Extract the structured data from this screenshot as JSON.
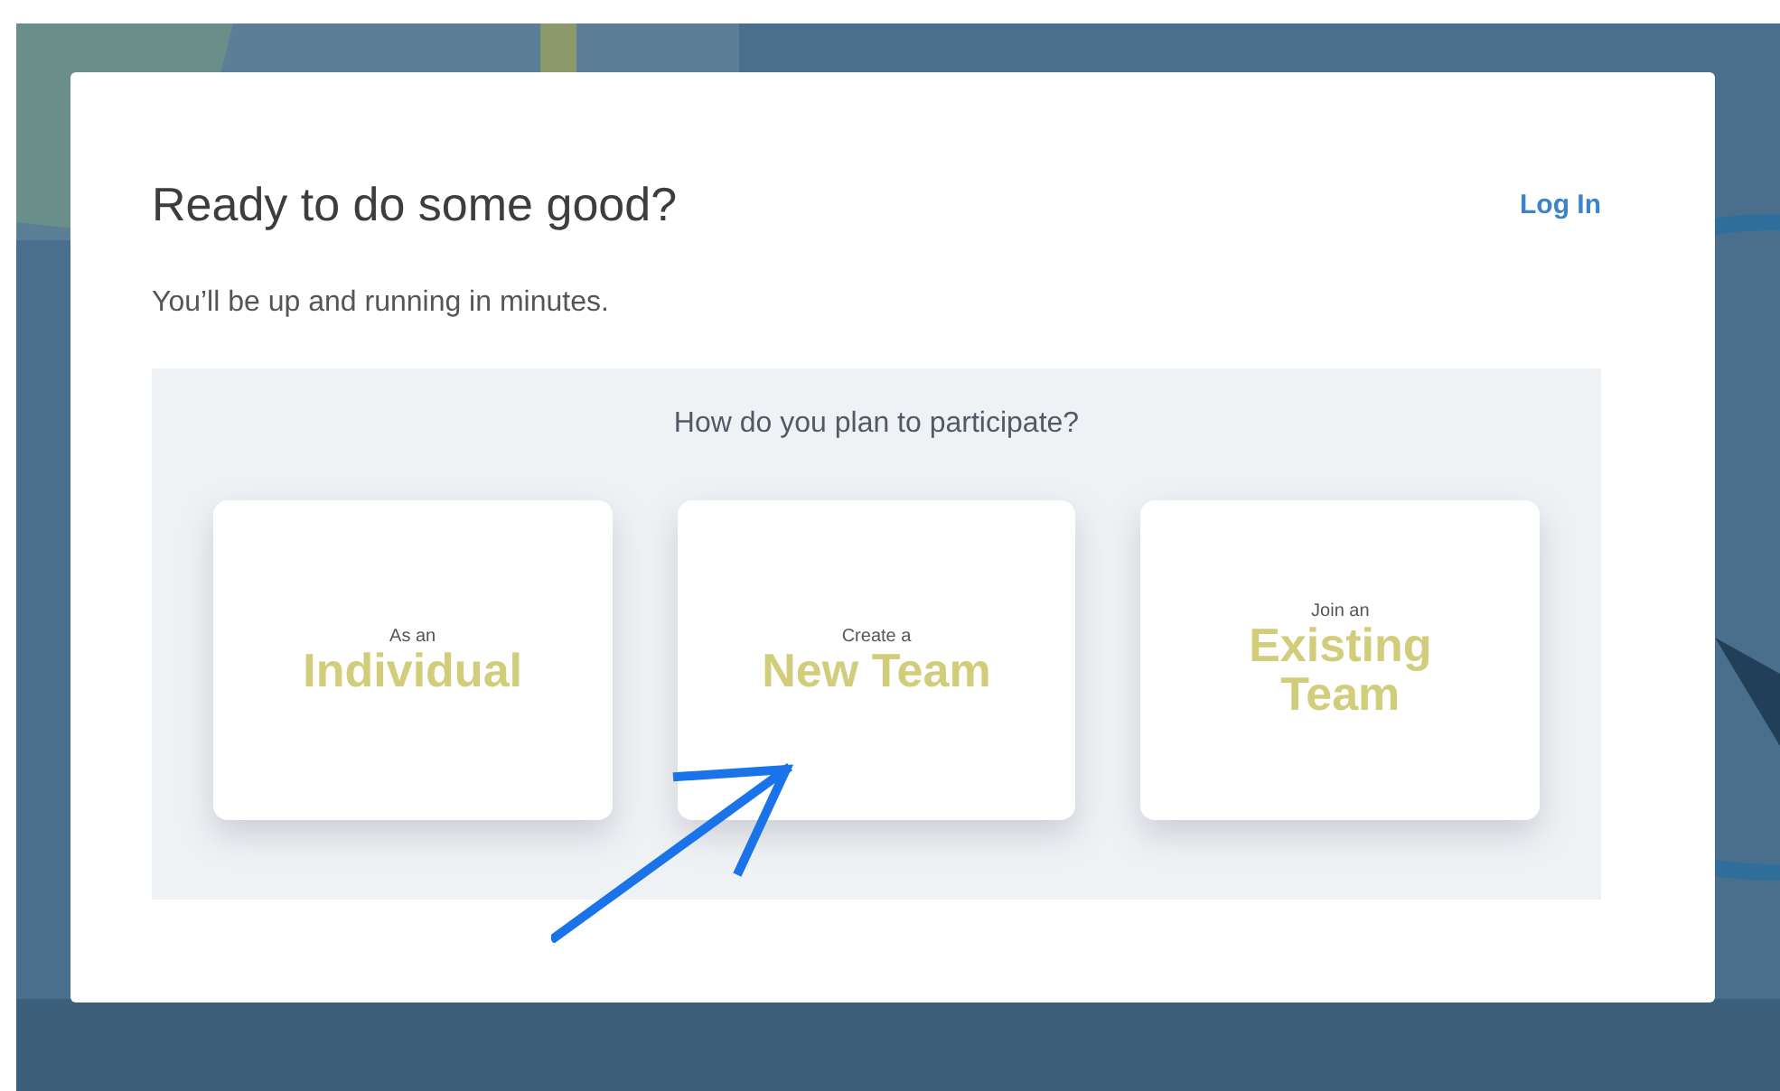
{
  "dialog": {
    "title": "Ready to do some good?",
    "login_link": "Log In",
    "subtitle": "You’ll be up and running in minutes.",
    "question": "How do you plan to participate?",
    "options": [
      {
        "prefix": "As an",
        "label": "Individual"
      },
      {
        "prefix": "Create a",
        "label": "New Team"
      },
      {
        "prefix": "Join an",
        "label": "Existing Team"
      }
    ]
  }
}
